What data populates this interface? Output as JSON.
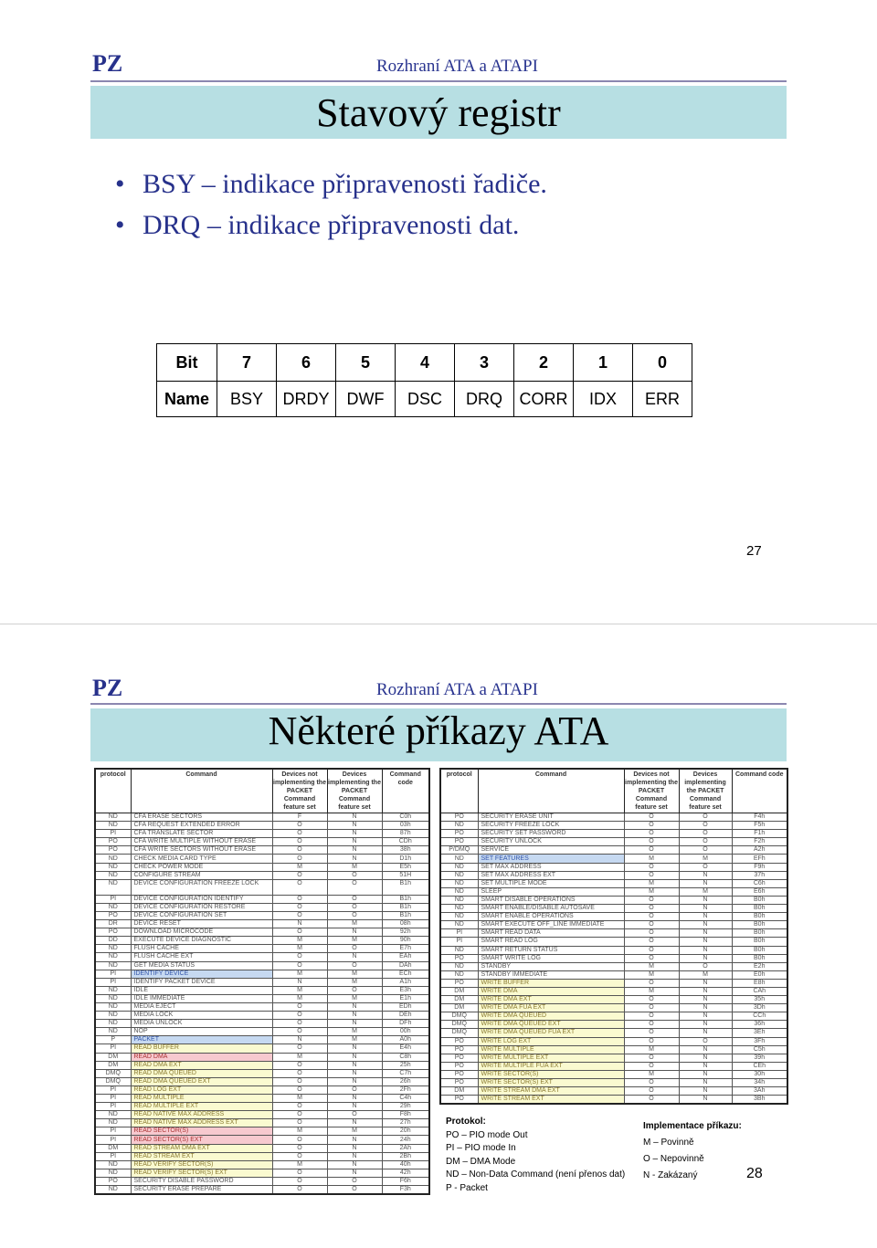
{
  "slide1": {
    "logo": "PZ",
    "subtitle": "Rozhraní ATA a ATAPI",
    "title": "Stavový registr",
    "bullets": [
      "BSY – indikace připravenosti řadiče.",
      "DRQ – indikace připravenosti dat."
    ],
    "register": {
      "bit_label": "Bit",
      "name_label": "Name",
      "bits": [
        "7",
        "6",
        "5",
        "4",
        "3",
        "2",
        "1",
        "0"
      ],
      "names": [
        "BSY",
        "DRDY",
        "DWF",
        "DSC",
        "DRQ",
        "CORR",
        "IDX",
        "ERR"
      ]
    },
    "page_number": "27"
  },
  "slide2": {
    "logo": "PZ",
    "subtitle": "Rozhraní ATA a ATAPI",
    "title": "Některé příkazy ATA",
    "headers": [
      "protocol",
      "Command",
      "Devices not implementing the PACKET Command feature set",
      "Devices implementing the PACKET Command feature set",
      "Command code"
    ],
    "highlight_colors": {
      "b": "#c6d9f1",
      "y": "#fafad0",
      "r": "#f7c9cf"
    },
    "left_rows": [
      [
        "ND",
        "CFA ERASE SECTORS",
        "F",
        "N",
        "C0h",
        ""
      ],
      [
        "ND",
        "CFA REQUEST EXTENDED ERROR",
        "O",
        "N",
        "03h",
        ""
      ],
      [
        "PI",
        "CFA TRANSLATE SECTOR",
        "O",
        "N",
        "87h",
        ""
      ],
      [
        "PO",
        "CFA WRITE MULTIPLE WITHOUT ERASE",
        "O",
        "N",
        "CDh",
        ""
      ],
      [
        "PO",
        "CFA WRITE SECTORS WITHOUT ERASE",
        "O",
        "N",
        "38h",
        ""
      ],
      [
        "ND",
        "CHECK MEDIA CARD TYPE",
        "O",
        "N",
        "D1h",
        ""
      ],
      [
        "ND",
        "CHECK POWER MODE",
        "M",
        "M",
        "E5h",
        ""
      ],
      [
        "ND",
        "CONFIGURE STREAM",
        "O",
        "O",
        "51H",
        ""
      ],
      [
        "ND",
        "DEVICE CONFIGURATION FREEZE LOCK",
        "O",
        "O",
        "B1h",
        "w"
      ],
      [
        "PI",
        "DEVICE CONFIGURATION IDENTIFY",
        "O",
        "O",
        "B1h",
        ""
      ],
      [
        "ND",
        "DEVICE CONFIGURATION RESTORE",
        "O",
        "O",
        "B1h",
        ""
      ],
      [
        "PO",
        "DEVICE CONFIGURATION SET",
        "O",
        "O",
        "B1h",
        ""
      ],
      [
        "DR",
        "DEVICE RESET",
        "N",
        "M",
        "08h",
        ""
      ],
      [
        "PO",
        "DOWNLOAD MICROCODE",
        "O",
        "N",
        "92h",
        ""
      ],
      [
        "DD",
        "EXECUTE DEVICE DIAGNOSTIC",
        "M",
        "M",
        "90h",
        ""
      ],
      [
        "ND",
        "FLUSH CACHE",
        "M",
        "O",
        "E7h",
        ""
      ],
      [
        "ND",
        "FLUSH CACHE EXT",
        "O",
        "N",
        "EAh",
        ""
      ],
      [
        "ND",
        "GET MEDIA STATUS",
        "O",
        "O",
        "DAh",
        ""
      ],
      [
        "PI",
        "IDENTIFY DEVICE",
        "M",
        "M",
        "ECh",
        "b"
      ],
      [
        "PI",
        "IDENTIFY PACKET DEVICE",
        "N",
        "M",
        "A1h",
        ""
      ],
      [
        "ND",
        "IDLE",
        "M",
        "O",
        "E3h",
        ""
      ],
      [
        "ND",
        "IDLE IMMEDIATE",
        "M",
        "M",
        "E1h",
        ""
      ],
      [
        "ND",
        "MEDIA EJECT",
        "O",
        "N",
        "EDh",
        ""
      ],
      [
        "ND",
        "MEDIA LOCK",
        "O",
        "N",
        "DEh",
        ""
      ],
      [
        "ND",
        "MEDIA UNLOCK",
        "O",
        "N",
        "DFh",
        ""
      ],
      [
        "ND",
        "NOP",
        "O",
        "M",
        "00h",
        ""
      ],
      [
        "P",
        "PACKET",
        "N",
        "M",
        "A0h",
        "b"
      ],
      [
        "PI",
        "READ BUFFER",
        "O",
        "N",
        "E4h",
        "y"
      ],
      [
        "DM",
        "READ DMA",
        "M",
        "N",
        "C8h",
        "r"
      ],
      [
        "DM",
        "READ DMA EXT",
        "O",
        "N",
        "25h",
        "y"
      ],
      [
        "DMQ",
        "READ DMA QUEUED",
        "O",
        "N",
        "C7h",
        "y"
      ],
      [
        "DMQ",
        "READ DMA QUEUED EXT",
        "O",
        "N",
        "26h",
        "y"
      ],
      [
        "PI",
        "READ LOG EXT",
        "O",
        "O",
        "2Fh",
        "y"
      ],
      [
        "PI",
        "READ MULTIPLE",
        "M",
        "N",
        "C4h",
        "y"
      ],
      [
        "PI",
        "READ MULTIPLE EXT",
        "O",
        "N",
        "29h",
        "y"
      ],
      [
        "ND",
        "READ NATIVE MAX ADDRESS",
        "O",
        "O",
        "F8h",
        "y"
      ],
      [
        "ND",
        "READ NATIVE MAX ADDRESS EXT",
        "O",
        "N",
        "27h",
        "y"
      ],
      [
        "PI",
        "READ SECTOR(S)",
        "M",
        "M",
        "20h",
        "r"
      ],
      [
        "PI",
        "READ SECTOR(S) EXT",
        "O",
        "N",
        "24h",
        "r"
      ],
      [
        "DM",
        "READ STREAM DMA EXT",
        "O",
        "N",
        "2Ah",
        "y"
      ],
      [
        "PI",
        "READ STREAM EXT",
        "O",
        "N",
        "2Bh",
        "y"
      ],
      [
        "ND",
        "READ VERIFY SECTOR(S)",
        "M",
        "N",
        "40h",
        "y"
      ],
      [
        "ND",
        "READ VERIFY SECTOR(S) EXT",
        "O",
        "N",
        "42h",
        "y"
      ],
      [
        "PO",
        "SECURITY DISABLE PASSWORD",
        "O",
        "O",
        "F6h",
        ""
      ],
      [
        "ND",
        "SECURITY ERASE PREPARE",
        "O",
        "O",
        "F3h",
        ""
      ]
    ],
    "right_rows": [
      [
        "PO",
        "SECURITY ERASE UNIT",
        "O",
        "O",
        "F4h",
        ""
      ],
      [
        "ND",
        "SECURITY FREEZE LOCK",
        "O",
        "O",
        "F5h",
        ""
      ],
      [
        "PO",
        "SECURITY SET PASSWORD",
        "O",
        "O",
        "F1h",
        ""
      ],
      [
        "PO",
        "SECURITY UNLOCK",
        "O",
        "O",
        "F2h",
        ""
      ],
      [
        "P/DMQ",
        "SERVICE",
        "O",
        "O",
        "A2h",
        ""
      ],
      [
        "ND",
        "SET FEATURES",
        "M",
        "M",
        "EFh",
        "b"
      ],
      [
        "ND",
        "SET MAX ADDRESS",
        "O",
        "O",
        "F9h",
        ""
      ],
      [
        "ND",
        "SET MAX ADDRESS EXT",
        "O",
        "N",
        "37h",
        ""
      ],
      [
        "ND",
        "SET MULTIPLE MODE",
        "M",
        "N",
        "C6h",
        ""
      ],
      [
        "ND",
        "SLEEP",
        "M",
        "M",
        "E6h",
        ""
      ],
      [
        "ND",
        "SMART DISABLE OPERATIONS",
        "O",
        "N",
        "B0h",
        ""
      ],
      [
        "ND",
        "SMART ENABLE/DISABLE AUTOSAVE",
        "O",
        "N",
        "B0h",
        ""
      ],
      [
        "ND",
        "SMART ENABLE OPERATIONS",
        "O",
        "N",
        "B0h",
        ""
      ],
      [
        "ND",
        "SMART EXECUTE OFF_LINE IMMEDIATE",
        "O",
        "N",
        "B0h",
        ""
      ],
      [
        "PI",
        "SMART READ DATA",
        "O",
        "N",
        "B0h",
        ""
      ],
      [
        "PI",
        "SMART READ LOG",
        "O",
        "N",
        "B0h",
        ""
      ],
      [
        "ND",
        "SMART RETURN STATUS",
        "O",
        "N",
        "B0h",
        ""
      ],
      [
        "PO",
        "SMART WRITE LOG",
        "O",
        "N",
        "B0h",
        ""
      ],
      [
        "ND",
        "STANDBY",
        "M",
        "O",
        "E2h",
        ""
      ],
      [
        "ND",
        "STANDBY IMMEDIATE",
        "M",
        "M",
        "E0h",
        ""
      ],
      [
        "PO",
        "WRITE BUFFER",
        "O",
        "N",
        "E8h",
        "y"
      ],
      [
        "DM",
        "WRITE DMA",
        "M",
        "N",
        "CAh",
        "y"
      ],
      [
        "DM",
        "WRITE DMA EXT",
        "O",
        "N",
        "35h",
        "y"
      ],
      [
        "DM",
        "WRITE DMA FUA EXT",
        "O",
        "N",
        "3Dh",
        "y"
      ],
      [
        "DMQ",
        "WRITE DMA QUEUED",
        "O",
        "N",
        "CCh",
        "y"
      ],
      [
        "DMQ",
        "WRITE DMA QUEUED EXT",
        "O",
        "N",
        "36h",
        "y"
      ],
      [
        "DMQ",
        "WRITE DMA QUEUED FUA EXT",
        "O",
        "N",
        "3Eh",
        "y"
      ],
      [
        "PO",
        "WRITE LOG EXT",
        "O",
        "O",
        "3Fh",
        "y"
      ],
      [
        "PO",
        "WRITE MULTIPLE",
        "M",
        "N",
        "C5h",
        "y"
      ],
      [
        "PO",
        "WRITE MULTIPLE EXT",
        "O",
        "N",
        "39h",
        "y"
      ],
      [
        "PO",
        "WRITE MULTIPLE FUA EXT",
        "O",
        "N",
        "CEh",
        "y"
      ],
      [
        "PO",
        "WRITE SECTOR(S)",
        "M",
        "N",
        "30h",
        "y"
      ],
      [
        "PO",
        "WRITE SECTOR(S) EXT",
        "O",
        "N",
        "34h",
        "y"
      ],
      [
        "DM",
        "WRITE STREAM DMA EXT",
        "O",
        "N",
        "3Ah",
        "y"
      ],
      [
        "PO",
        "WRITE STREAM EXT",
        "O",
        "N",
        "3Bh",
        "y"
      ]
    ],
    "protocol_legend": {
      "heading": "Protokol:",
      "items": [
        "PO – PIO mode Out",
        "PI – PIO mode In",
        "DM – DMA Mode",
        "ND – Non-Data Command (není přenos dat)",
        "P - Packet"
      ]
    },
    "impl_legend": {
      "heading": "Implementace příkazu:",
      "items": [
        "M – Povinně",
        "O – Nepovinně",
        "N - Zakázaný"
      ]
    },
    "page_number": "28"
  }
}
